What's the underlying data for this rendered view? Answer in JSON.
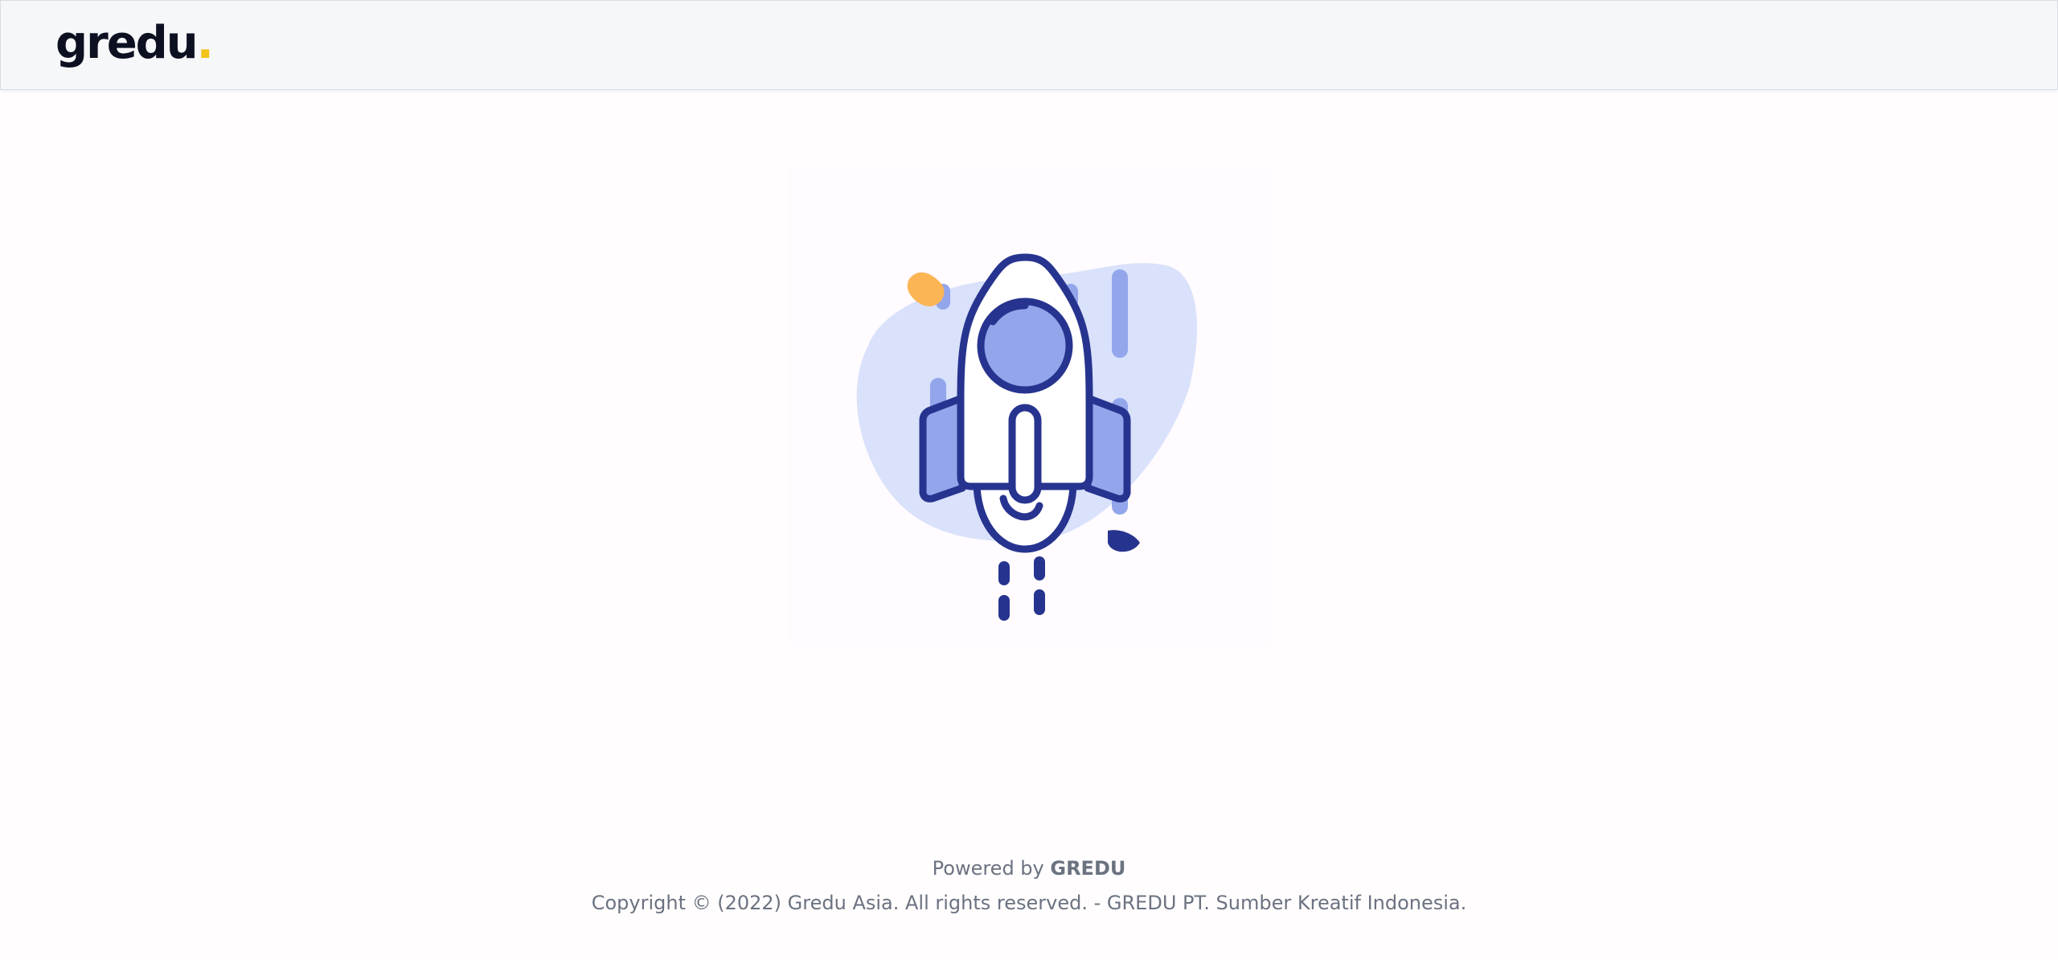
{
  "header": {
    "logo_text": "gredu",
    "logo_dot": "."
  },
  "hero": {
    "icon": "rocket-icon"
  },
  "footer": {
    "powered_prefix": "Powered by ",
    "powered_brand": "GREDU",
    "copyright": "Copyright © (2022) Gredu Asia. All rights reserved. - GREDU PT. Sumber Kreatif Indonesia."
  },
  "colors": {
    "navy": "#27348f",
    "blob": "#d9e1fb",
    "fill": "#93a5eb",
    "accent": "#fbb555",
    "logo_dot": "#f2c31c"
  }
}
